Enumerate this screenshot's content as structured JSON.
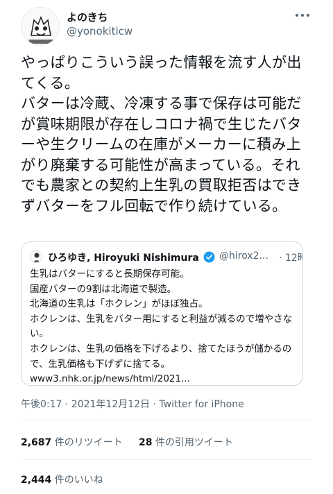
{
  "tweet": {
    "display_name": "よのきち",
    "handle": "@yonokiticw",
    "more_icon": "more-horizontal-icon",
    "text": "やっぱりこういう誤った情報を流す人が出てくる。\nバターは冷蔵、冷凍する事で保存は可能だが賞味期限が存在しコロナ禍で生じたバターや生クリームの在庫がメーカーに積み上がり廃棄する可能性が高まっている。それでも農家との契約上生乳の買取拒否はできずバターをフル回転で作り続けている。",
    "timestamp": "午後0:17 · 2021年12月12日 · Twitter for iPhone"
  },
  "quote": {
    "display_name": "ひろゆき, Hiroyuki Nishimura",
    "verified_icon": "verified-badge-icon",
    "handle": "@hirox2...",
    "time": "· 12時間",
    "text": "生乳はバターにすると長期保存可能。\n国産バターの9割は北海道で製造。\n北海道の生乳は「ホクレン」がほぼ独占。\nホクレンは、生乳をバター用にすると利益が減るので増やさない。\nホクレンは、生乳の価格を下げるより、捨てたほうが儲かるので、生乳価格も下げずに捨てる。\nwww3.nhk.or.jp/news/html/2021..."
  },
  "stats": {
    "retweets_count": "2,687",
    "retweets_label": " 件のリツイート",
    "quotes_count": "28",
    "quotes_label": " 件の引用ツイート",
    "likes_count": "2,444",
    "likes_label": " 件のいいね"
  },
  "colors": {
    "text": "#0f1419",
    "secondary": "#536471",
    "verified": "#1d9bf0",
    "border": "#cfd9de"
  }
}
